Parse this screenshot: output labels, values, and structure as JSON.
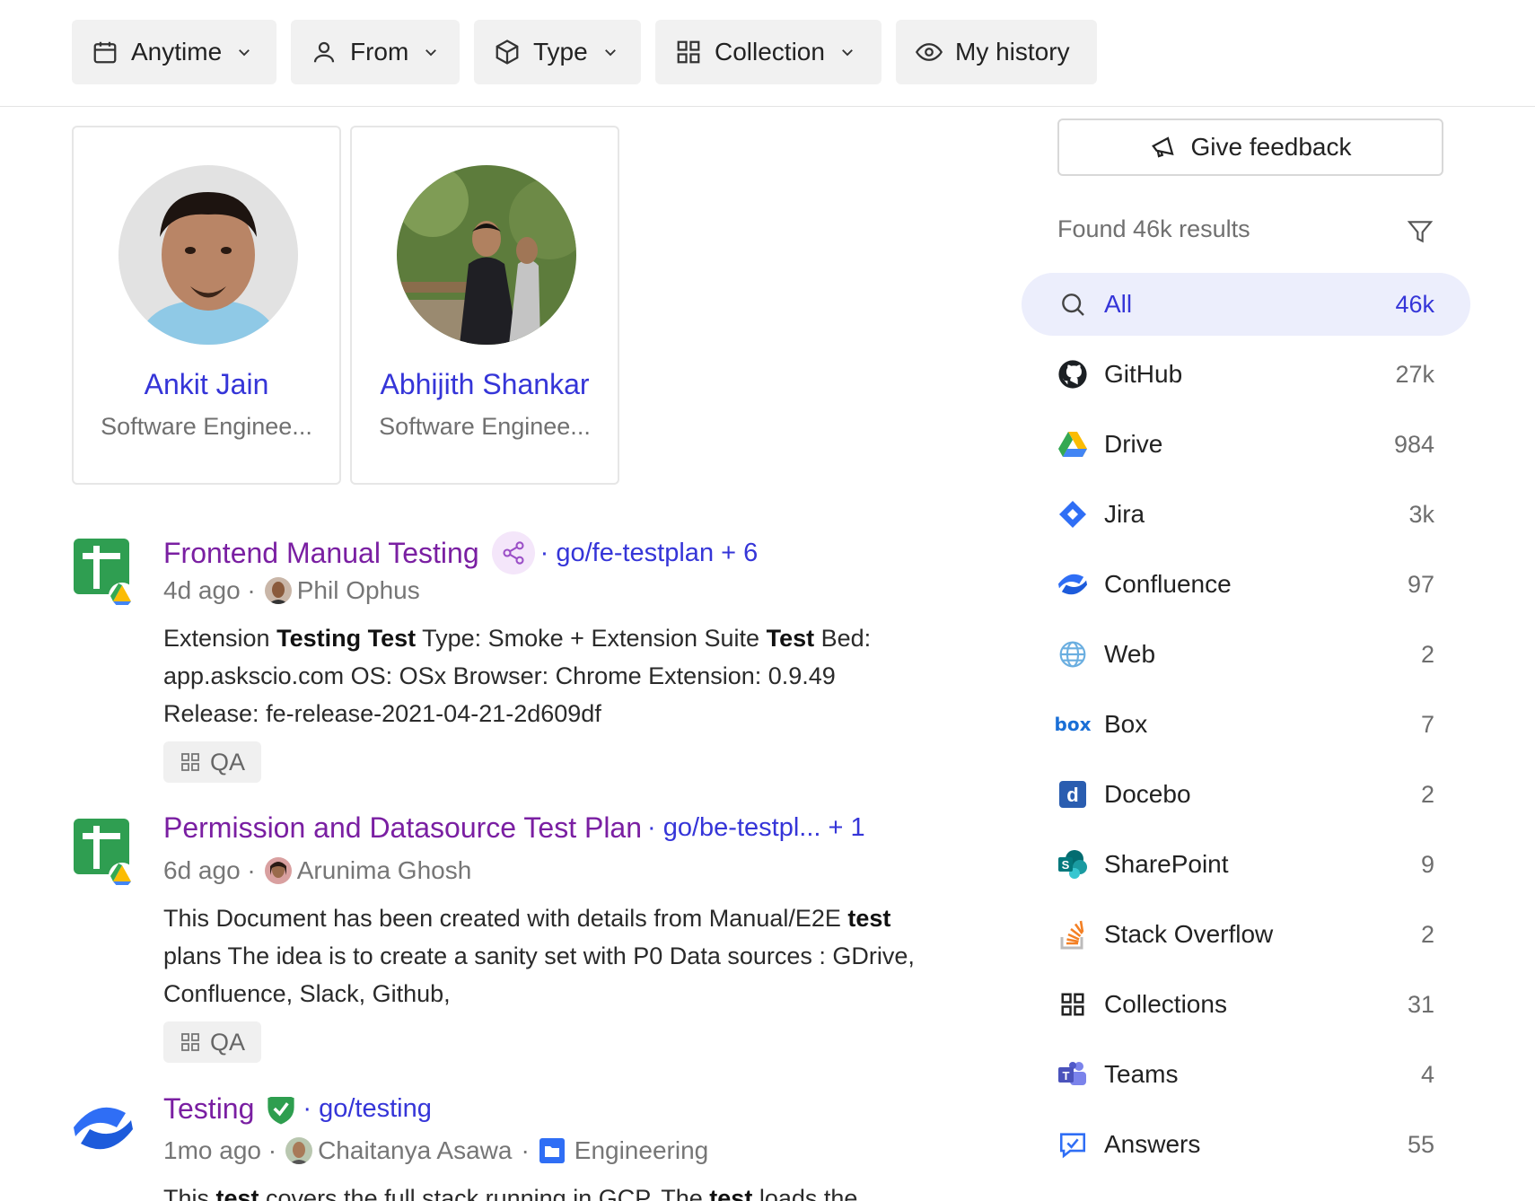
{
  "filters": [
    {
      "label": "Anytime",
      "icon": "calendar-icon"
    },
    {
      "label": "From",
      "icon": "person-icon"
    },
    {
      "label": "Type",
      "icon": "cube-icon"
    },
    {
      "label": "Collection",
      "icon": "grid-icon"
    },
    {
      "label": "My history",
      "icon": "eye-icon"
    }
  ],
  "people": [
    {
      "name": "Ankit Jain",
      "role": "Software Enginee..."
    },
    {
      "name": "Abhijith Shankar",
      "role": "Software Enginee..."
    }
  ],
  "results": [
    {
      "title": "Frontend Manual Testing",
      "golink": "· go/fe-testplan + 6",
      "time": "4d ago ·",
      "author": "Phil Ophus",
      "snippet_html": "Extension <b>Testing Test</b> Type: Smoke + Extension Suite <b>Test</b> Bed: app.askscio.com OS: OSx Browser: Chrome Extension: 0.9.49 Release: fe-release-2021-04-21-2d609df",
      "tag": "QA"
    },
    {
      "title": "Permission and Datasource Test Plan",
      "golink": "· go/be-testpl...  + 1",
      "time": "6d ago ·",
      "author": "Arunima Ghosh",
      "snippet_html": "This Document has been created with details from Manual/E2E <b>test</b> plans The idea is to create a sanity set with P0 Data sources : GDrive, Confluence, Slack, Github,",
      "tag": "QA"
    },
    {
      "title": "Testing",
      "golink": "· go/testing",
      "time": "1mo ago ·",
      "author": "Chaitanya Asawa",
      "space_sep": "·",
      "space": "Engineering",
      "snippet_html": "This <b>test</b> covers the full stack running in GCP. The <b>test</b> loads the"
    }
  ],
  "sidebar": {
    "feedback_label": "Give feedback",
    "found_text": "Found 46k results",
    "sources": [
      {
        "label": "All",
        "count": "46k",
        "icon": "search-icon",
        "active": true
      },
      {
        "label": "GitHub",
        "count": "27k",
        "icon": "github-icon"
      },
      {
        "label": "Drive",
        "count": "984",
        "icon": "drive-icon"
      },
      {
        "label": "Jira",
        "count": "3k",
        "icon": "jira-icon"
      },
      {
        "label": "Confluence",
        "count": "97",
        "icon": "confluence-icon"
      },
      {
        "label": "Web",
        "count": "2",
        "icon": "globe-icon"
      },
      {
        "label": "Box",
        "count": "7",
        "icon": "box-icon"
      },
      {
        "label": "Docebo",
        "count": "2",
        "icon": "docebo-icon"
      },
      {
        "label": "SharePoint",
        "count": "9",
        "icon": "sharepoint-icon"
      },
      {
        "label": "Stack Overflow",
        "count": "2",
        "icon": "stackoverflow-icon"
      },
      {
        "label": "Collections",
        "count": "31",
        "icon": "grid-icon"
      },
      {
        "label": "Teams",
        "count": "4",
        "icon": "teams-icon"
      },
      {
        "label": "Answers",
        "count": "55",
        "icon": "answers-icon"
      }
    ]
  },
  "colors": {
    "accent": "#3535d8",
    "title_purple": "#7a1fa2",
    "active_bg": "#eceefc"
  }
}
